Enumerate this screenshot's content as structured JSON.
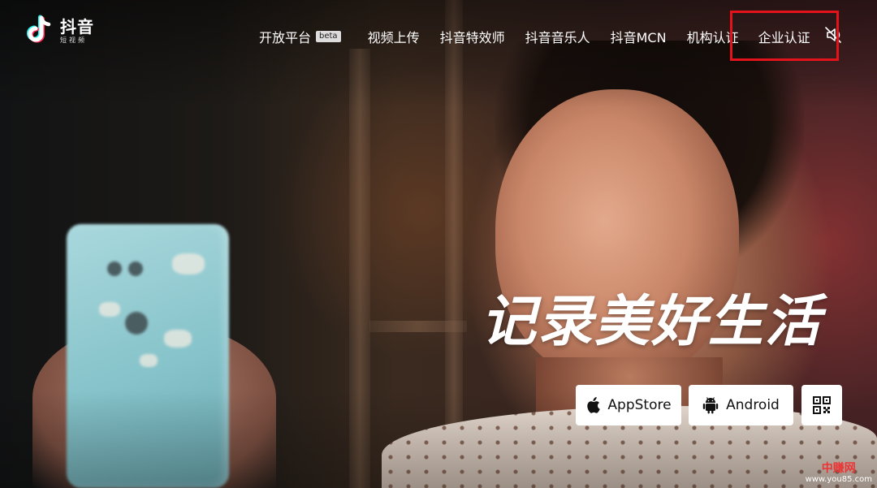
{
  "brand": {
    "name": "抖音",
    "subtitle": "短视频"
  },
  "nav": {
    "items": [
      {
        "label": "开放平台",
        "badge": "beta"
      },
      {
        "label": "视频上传"
      },
      {
        "label": "抖音特效师"
      },
      {
        "label": "抖音音乐人"
      },
      {
        "label": "抖音MCN"
      },
      {
        "label": "机构认证"
      },
      {
        "label": "企业认证"
      }
    ],
    "sound_icon": "speaker-muted-icon",
    "highlight_color": "#e3121b"
  },
  "hero": {
    "slogan": "记录美好生活",
    "buttons": {
      "appstore_label": "AppStore",
      "appstore_icon": "apple-icon",
      "android_label": "Android",
      "android_icon": "android-icon",
      "qr_icon": "qr-code-icon"
    }
  },
  "watermark": {
    "top": "中赚网",
    "bottom": "www.you85.com"
  }
}
